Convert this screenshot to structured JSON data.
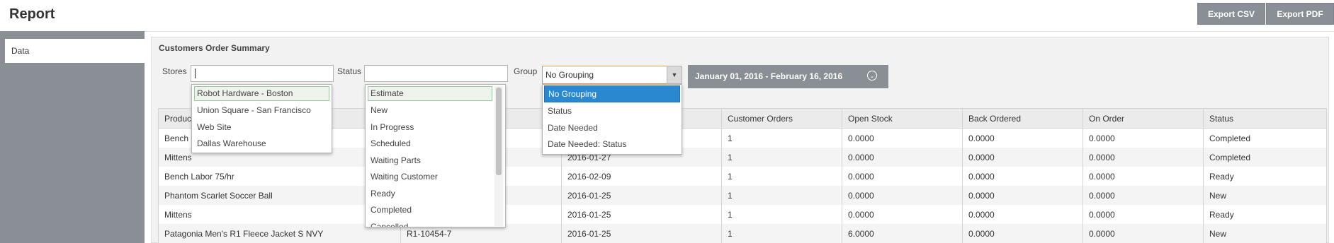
{
  "header": {
    "title": "Report",
    "export_csv": "Export CSV",
    "export_pdf": "Export PDF"
  },
  "sidebar": {
    "items": [
      {
        "label": "Data"
      }
    ]
  },
  "panel": {
    "title": "Customers Order Summary",
    "filters": {
      "stores_label": "Stores",
      "stores_value": "",
      "status_label": "Status",
      "status_value": "",
      "group_label": "Group",
      "group_value": "No Grouping",
      "date_range": "January 01, 2016 - February 16, 2016"
    }
  },
  "dropdowns": {
    "stores": [
      "Robot Hardware - Boston",
      "Union Square - San Francisco",
      "Web Site",
      "Dallas Warehouse"
    ],
    "status": [
      "Estimate",
      "New",
      "In Progress",
      "Scheduled",
      "Waiting Parts",
      "Waiting Customer",
      "Ready",
      "Completed",
      "Cancelled"
    ],
    "group": [
      "No Grouping",
      "Status",
      "Date Needed",
      "Date Needed: Status"
    ]
  },
  "table": {
    "columns": [
      "Produc",
      "",
      "",
      "Customer Orders",
      "Open Stock",
      "Back Ordered",
      "On Order",
      "Status"
    ],
    "rows": [
      [
        "Bench",
        "",
        "",
        "1",
        "0.0000",
        "0.0000",
        "0.0000",
        "Completed"
      ],
      [
        "Mittens",
        "",
        "2016-01-27",
        "1",
        "0.0000",
        "0.0000",
        "0.0000",
        "Completed"
      ],
      [
        "Bench Labor 75/hr",
        "",
        "2016-02-09",
        "1",
        "0.0000",
        "0.0000",
        "0.0000",
        "Ready"
      ],
      [
        "Phantom Scarlet Soccer Ball",
        "",
        "2016-01-25",
        "1",
        "0.0000",
        "0.0000",
        "0.0000",
        "New"
      ],
      [
        "Mittens",
        "",
        "2016-01-25",
        "1",
        "0.0000",
        "0.0000",
        "0.0000",
        "Ready"
      ],
      [
        "Patagonia Men's R1 Fleece Jacket S NVY",
        "R1-10454-7",
        "2016-01-25",
        "1",
        "6.0000",
        "0.0000",
        "0.0000",
        "New"
      ]
    ]
  },
  "colors": {
    "sidebar_bg": "#8a8f96",
    "button_bg": "#8a8f96",
    "selected_item": "#2a88d1",
    "group_border": "#d99a4a"
  },
  "icons": {
    "group_dropdown": "triangle-down-icon",
    "date_toggle": "chevron-down-circle-icon"
  }
}
